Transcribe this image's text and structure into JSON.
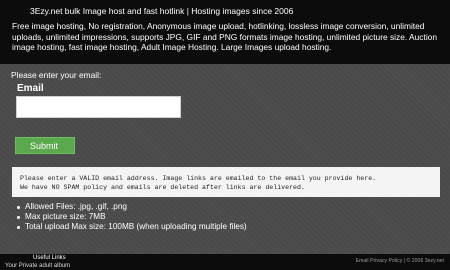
{
  "header": {
    "title": "3Ezy.net bulk Image host and fast hotlink | Hosting images since 2006",
    "description": "Free image hosting, No registration, Anonymous image upload, hotlinking, lossless image conversion, unlimited uploads, unlimited impressions, supports JPG, GIF and PNG formats image hosting, unlimited picture size. Auction image hosting, fast image hosting, Adult Image Hosting. Large Images upload hosting."
  },
  "form": {
    "prompt": "Please enter your email:",
    "email_label": "Email",
    "email_value": "",
    "email_placeholder": "",
    "submit_label": "Submit"
  },
  "notice": {
    "line1": "Please enter a VALID email address. Image links are emailed to the email you provide here.",
    "line2": "We have NO SPAM policy and emails are deleted after links are delivered."
  },
  "info": {
    "items": [
      "Allowed Files: .jpg, .gif, .png",
      "Max picture size: 7MB",
      "Total upload Max size: 100MB (when uploading multiple files)"
    ]
  },
  "footer": {
    "useful_links_label": "Useful Links",
    "links": [
      "Your Private adult album"
    ],
    "copyright": "Email Privacy Policy | © 2006 3ezy.net"
  },
  "colors": {
    "header_bg": "#0c0c0c",
    "main_bg": "#4a4a4a",
    "submit_bg": "#5ba84f",
    "notice_bg": "#f4f4f4"
  }
}
